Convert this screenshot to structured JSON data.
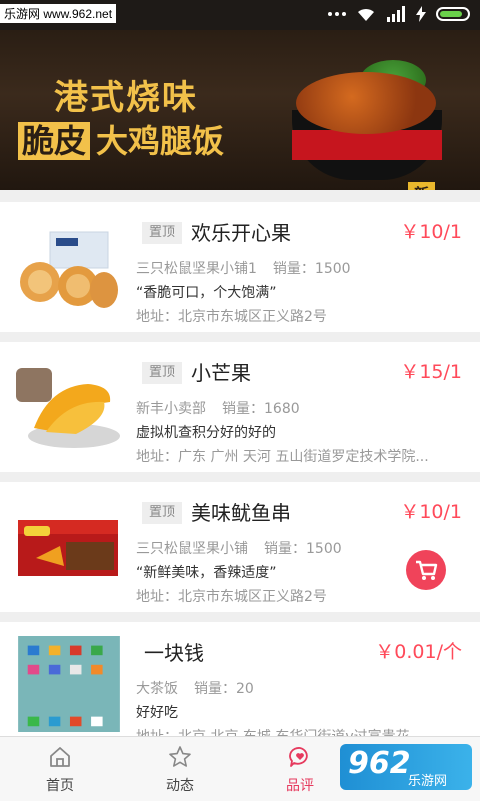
{
  "statusbar": {
    "watermark": "乐游网 www.962.net"
  },
  "banner": {
    "line1": "港式烧味",
    "line2_highlight": "脆皮",
    "line2_rest": "大鸡腿饭",
    "badge": "新",
    "active_index": 0,
    "dot_count": 3
  },
  "items": [
    {
      "tag": "置顶",
      "title": "欢乐开心果",
      "price": "￥10/1",
      "shop": "三只松鼠坚果小铺1",
      "sales": "销量：1500",
      "desc": "“香脆可口，个大饱满”",
      "address": "地址：北京市东城区正义路2号",
      "cart": false
    },
    {
      "tag": "置顶",
      "title": "小芒果",
      "price": "￥15/1",
      "shop": "新丰小卖部",
      "sales": "销量：1680",
      "desc": "虚拟机查积分好的好的",
      "address": "地址：广东 广州 天河 五山街道罗定技术学院...",
      "cart": false
    },
    {
      "tag": "置顶",
      "title": "美味鱿鱼串",
      "price": "￥10/1",
      "shop": "三只松鼠坚果小铺",
      "sales": "销量：1500",
      "desc": "“新鲜美味，香辣适度”",
      "address": "地址：北京市东城区正义路2号",
      "cart": true
    },
    {
      "tag": "",
      "title": "一块钱",
      "price": "￥0.01/个",
      "shop": "大茶饭",
      "sales": "销量：20",
      "desc": "好好吃",
      "address": "地址：北京 北京 东城 东华门街道v过富贵花",
      "cart": false
    }
  ],
  "tabs": [
    {
      "label": "首页",
      "icon": "home-icon"
    },
    {
      "label": "动态",
      "icon": "star-icon"
    },
    {
      "label": "品评",
      "icon": "comment-heart-icon"
    },
    {
      "label": "",
      "icon": "user-icon"
    }
  ],
  "watermark_bottom": {
    "big": "962",
    "small": "乐游网"
  },
  "colors": {
    "accent": "#ff4a5a",
    "tab_active": "#e63a5e",
    "banner_gold": "#f2c14a"
  }
}
